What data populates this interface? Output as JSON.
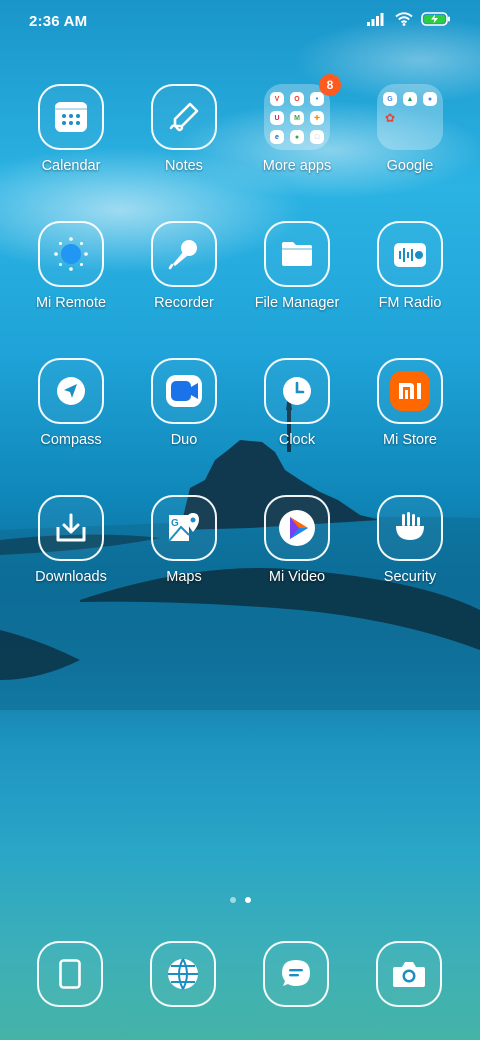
{
  "status_bar": {
    "time": "2:36 AM",
    "icons": [
      "signal-icon",
      "wifi-icon",
      "battery-charging-icon"
    ],
    "battery_color": "#2ecc40"
  },
  "apps": {
    "row1": [
      {
        "label": "Calendar",
        "icon": "calendar-icon"
      },
      {
        "label": "Notes",
        "icon": "notes-icon"
      },
      {
        "label": "More apps",
        "icon": "folder-more-apps",
        "badge": "8"
      },
      {
        "label": "Google",
        "icon": "folder-google"
      }
    ],
    "row2": [
      {
        "label": "Mi Remote",
        "icon": "mi-remote-icon"
      },
      {
        "label": "Recorder",
        "icon": "microphone-icon"
      },
      {
        "label": "File Manager",
        "icon": "folder-icon"
      },
      {
        "label": "FM Radio",
        "icon": "radio-icon"
      }
    ],
    "row3": [
      {
        "label": "Compass",
        "icon": "compass-icon"
      },
      {
        "label": "Duo",
        "icon": "duo-video-icon"
      },
      {
        "label": "Clock",
        "icon": "clock-icon"
      },
      {
        "label": "Mi Store",
        "icon": "mi-store-icon"
      }
    ],
    "row4": [
      {
        "label": "Downloads",
        "icon": "download-icon"
      },
      {
        "label": "Maps",
        "icon": "maps-icon"
      },
      {
        "label": "Mi Video",
        "icon": "mi-video-icon"
      },
      {
        "label": "Security",
        "icon": "security-icon"
      }
    ]
  },
  "page_indicator": {
    "pages": 2,
    "active": 2
  },
  "dock": [
    "phone-icon",
    "browser-globe-icon",
    "messages-icon",
    "camera-icon"
  ],
  "colors": {
    "mi_store": "#ff6700",
    "badge": "#ff5a1f",
    "accent_blue": "#2196f3"
  }
}
